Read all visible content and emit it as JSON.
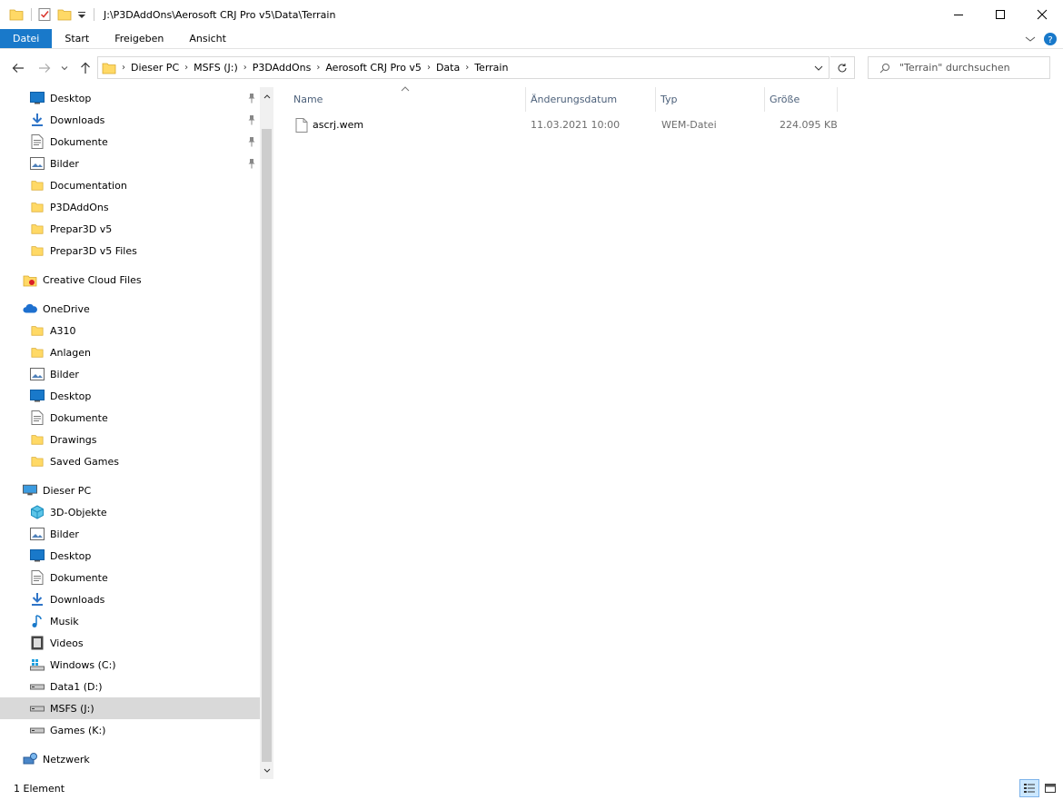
{
  "window": {
    "title": "J:\\P3DAddOns\\Aerosoft CRJ Pro v5\\Data\\Terrain",
    "controls": [
      "minimize-icon",
      "maximize-icon",
      "close-icon"
    ]
  },
  "ribbon": {
    "tabs": [
      {
        "label": "Datei",
        "active": true
      },
      {
        "label": "Start"
      },
      {
        "label": "Freigeben"
      },
      {
        "label": "Ansicht"
      }
    ]
  },
  "address": {
    "crumbs": [
      "Dieser PC",
      "MSFS (J:)",
      "P3DAddOns",
      "Aerosoft CRJ Pro v5",
      "Data",
      "Terrain"
    ],
    "search_placeholder": "\"Terrain\" durchsuchen"
  },
  "sidebar": {
    "items": [
      {
        "label": "Desktop",
        "icon": "desktop-icon",
        "pinned": true
      },
      {
        "label": "Downloads",
        "icon": "download-icon",
        "pinned": true
      },
      {
        "label": "Dokumente",
        "icon": "document-icon",
        "pinned": true
      },
      {
        "label": "Bilder",
        "icon": "pictures-icon",
        "pinned": true
      },
      {
        "label": "Documentation",
        "icon": "folder-icon"
      },
      {
        "label": "P3DAddOns",
        "icon": "folder-icon"
      },
      {
        "label": "Prepar3D v5",
        "icon": "folder-icon"
      },
      {
        "label": "Prepar3D v5 Files",
        "icon": "folder-icon"
      },
      {
        "label": "Creative Cloud Files",
        "icon": "creative-cloud-icon",
        "top_level": true
      },
      {
        "label": "OneDrive",
        "icon": "onedrive-icon",
        "top_level": true
      },
      {
        "label": "A310",
        "icon": "folder-icon"
      },
      {
        "label": "Anlagen",
        "icon": "folder-icon"
      },
      {
        "label": "Bilder",
        "icon": "pictures-icon"
      },
      {
        "label": "Desktop",
        "icon": "desktop-icon"
      },
      {
        "label": "Dokumente",
        "icon": "document-icon"
      },
      {
        "label": "Drawings",
        "icon": "folder-icon"
      },
      {
        "label": "Saved Games",
        "icon": "folder-icon"
      },
      {
        "label": "Dieser PC",
        "icon": "computer-icon",
        "top_level": true
      },
      {
        "label": "3D-Objekte",
        "icon": "3d-objects-icon"
      },
      {
        "label": "Bilder",
        "icon": "pictures-icon"
      },
      {
        "label": "Desktop",
        "icon": "desktop-icon"
      },
      {
        "label": "Dokumente",
        "icon": "document-icon"
      },
      {
        "label": "Downloads",
        "icon": "download-icon"
      },
      {
        "label": "Musik",
        "icon": "music-icon"
      },
      {
        "label": "Videos",
        "icon": "video-icon"
      },
      {
        "label": "Windows (C:)",
        "icon": "windows-drive-icon"
      },
      {
        "label": "Data1 (D:)",
        "icon": "drive-icon"
      },
      {
        "label": "MSFS (J:)",
        "icon": "drive-icon",
        "selected": true
      },
      {
        "label": "Games (K:)",
        "icon": "drive-icon"
      },
      {
        "label": "Netzwerk",
        "icon": "network-icon",
        "top_level": true
      }
    ]
  },
  "columns": {
    "name": "Name",
    "date": "Änderungsdatum",
    "type": "Typ",
    "size": "Größe"
  },
  "files": [
    {
      "name": "ascrj.wem",
      "date": "11.03.2021 10:00",
      "type": "WEM-Datei",
      "size": "224.095 KB",
      "icon": "file-icon"
    }
  ],
  "status": {
    "text": "1 Element"
  },
  "colors": {
    "accent": "#1979ca",
    "folder": "#ffd966",
    "selection": "#d9d9d9"
  }
}
